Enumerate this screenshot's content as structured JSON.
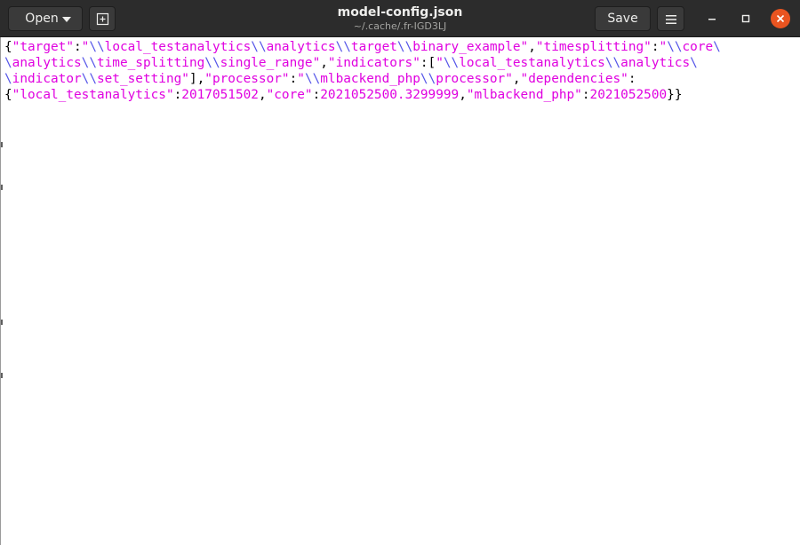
{
  "headerbar": {
    "open_label": "Open",
    "title": "model-config.json",
    "subtitle": "~/.cache/.fr-IGD3LJ",
    "save_label": "Save"
  },
  "icons": {
    "open_dropdown": "chevron-down-icon",
    "new_document": "new-document-icon",
    "menu": "hamburger-menu-icon",
    "minimize": "minimize-icon",
    "maximize": "maximize-icon",
    "close": "close-icon"
  },
  "colors": {
    "headerbar_bg": "#2c2c2c",
    "close_button": "#e95420",
    "json_string": "#e000e0",
    "json_escape": "#5555e8",
    "json_punctuation": "#000000"
  },
  "document": {
    "lines": [
      [
        {
          "t": "{",
          "c": "punc"
        },
        {
          "t": "\"target\"",
          "c": "str"
        },
        {
          "t": ":",
          "c": "punc"
        },
        {
          "t": "\"",
          "c": "str"
        },
        {
          "t": "\\\\",
          "c": "esc"
        },
        {
          "t": "local_testanalytics",
          "c": "str"
        },
        {
          "t": "\\\\",
          "c": "esc"
        },
        {
          "t": "analytics",
          "c": "str"
        },
        {
          "t": "\\\\",
          "c": "esc"
        },
        {
          "t": "target",
          "c": "str"
        },
        {
          "t": "\\\\",
          "c": "esc"
        },
        {
          "t": "binary_example\"",
          "c": "str"
        },
        {
          "t": ",",
          "c": "punc"
        },
        {
          "t": "\"timesplitting\"",
          "c": "str"
        },
        {
          "t": ":",
          "c": "punc"
        },
        {
          "t": "\"",
          "c": "str"
        },
        {
          "t": "\\\\",
          "c": "esc"
        },
        {
          "t": "core",
          "c": "str"
        },
        {
          "t": "\\",
          "c": "esc"
        }
      ],
      [
        {
          "t": "\\",
          "c": "esc"
        },
        {
          "t": "analytics",
          "c": "str"
        },
        {
          "t": "\\\\",
          "c": "esc"
        },
        {
          "t": "time_splitting",
          "c": "str"
        },
        {
          "t": "\\\\",
          "c": "esc"
        },
        {
          "t": "single_range\"",
          "c": "str"
        },
        {
          "t": ",",
          "c": "punc"
        },
        {
          "t": "\"indicators\"",
          "c": "str"
        },
        {
          "t": ":[",
          "c": "punc"
        },
        {
          "t": "\"",
          "c": "str"
        },
        {
          "t": "\\\\",
          "c": "esc"
        },
        {
          "t": "local_testanalytics",
          "c": "str"
        },
        {
          "t": "\\\\",
          "c": "esc"
        },
        {
          "t": "analytics",
          "c": "str"
        },
        {
          "t": "\\",
          "c": "esc"
        }
      ],
      [
        {
          "t": "\\",
          "c": "esc"
        },
        {
          "t": "indicator",
          "c": "str"
        },
        {
          "t": "\\\\",
          "c": "esc"
        },
        {
          "t": "set_setting\"",
          "c": "str"
        },
        {
          "t": "],",
          "c": "punc"
        },
        {
          "t": "\"processor\"",
          "c": "str"
        },
        {
          "t": ":",
          "c": "punc"
        },
        {
          "t": "\"",
          "c": "str"
        },
        {
          "t": "\\\\",
          "c": "esc"
        },
        {
          "t": "mlbackend_php",
          "c": "str"
        },
        {
          "t": "\\\\",
          "c": "esc"
        },
        {
          "t": "processor\"",
          "c": "str"
        },
        {
          "t": ",",
          "c": "punc"
        },
        {
          "t": "\"dependencies\"",
          "c": "str"
        },
        {
          "t": ":",
          "c": "punc"
        }
      ],
      [
        {
          "t": "{",
          "c": "punc"
        },
        {
          "t": "\"local_testanalytics\"",
          "c": "str"
        },
        {
          "t": ":",
          "c": "punc"
        },
        {
          "t": "2017051502",
          "c": "num"
        },
        {
          "t": ",",
          "c": "punc"
        },
        {
          "t": "\"core\"",
          "c": "str"
        },
        {
          "t": ":",
          "c": "punc"
        },
        {
          "t": "2021052500.3299999",
          "c": "num"
        },
        {
          "t": ",",
          "c": "punc"
        },
        {
          "t": "\"mlbackend_php\"",
          "c": "str"
        },
        {
          "t": ":",
          "c": "punc"
        },
        {
          "t": "2021052500",
          "c": "num"
        },
        {
          "t": "}}",
          "c": "punc"
        }
      ]
    ]
  }
}
